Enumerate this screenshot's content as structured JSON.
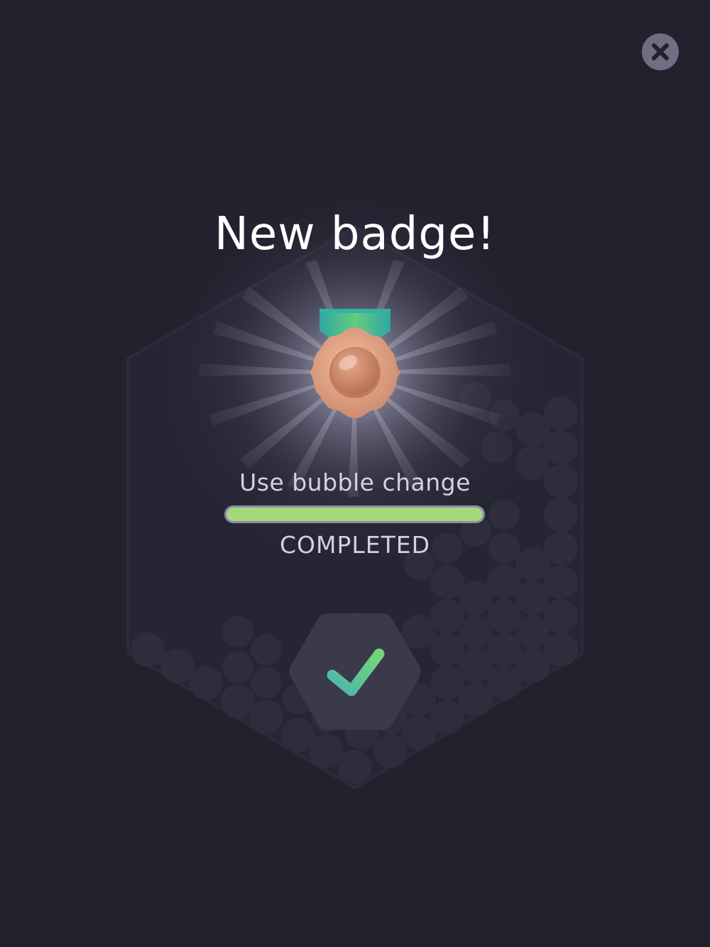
{
  "popup": {
    "title": "New badge!",
    "task_label": "Use bubble change",
    "progress": 1.0,
    "status": "COMPLETED"
  },
  "icons": {
    "close": "close-x-icon",
    "badge": "bronze-medal-icon",
    "confirm": "checkmark-icon"
  },
  "colors": {
    "background": "#22212e",
    "progress_fill": "#a3d97a",
    "progress_track": "#8f8ca6",
    "medal_bronze": "#e1a585",
    "ribbon_green": "#47b98c",
    "check_green": "#5fcf7a",
    "close_button": "#6f6e82"
  }
}
